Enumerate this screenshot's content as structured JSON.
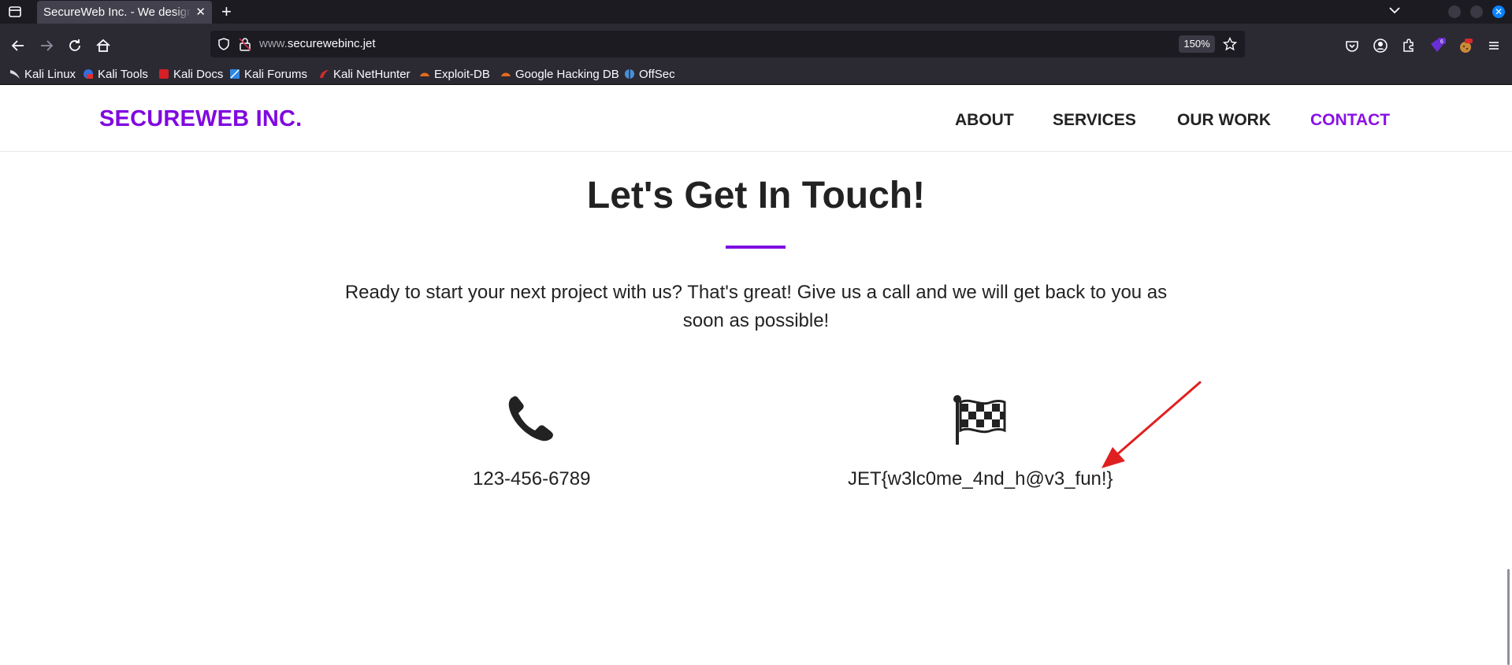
{
  "browser": {
    "tab_title": "SecureWeb Inc. - We design",
    "tab_close": "✕",
    "new_tab": "+",
    "url_prefix": "www.",
    "url_domain": "securewebinc.jet",
    "zoom": "150%",
    "extension_badge": "6",
    "bookmarks": [
      {
        "label": "Kali Linux",
        "icon": "kali-dragon-icon",
        "color": "#000000"
      },
      {
        "label": "Kali Tools",
        "icon": "kali-tools-icon",
        "color": "#2f6fe0"
      },
      {
        "label": "Kali Docs",
        "icon": "kali-docs-icon",
        "color": "#d61f26"
      },
      {
        "label": "Kali Forums",
        "icon": "kali-forums-icon",
        "color": "#2f86e0"
      },
      {
        "label": "Kali NetHunter",
        "icon": "nethunter-icon",
        "color": "#d52b2b"
      },
      {
        "label": "Exploit-DB",
        "icon": "exploit-db-icon",
        "color": "#e46a1e"
      },
      {
        "label": "Google Hacking DB",
        "icon": "ghdb-icon",
        "color": "#e46a1e"
      },
      {
        "label": "OffSec",
        "icon": "offsec-icon",
        "color": "#4a90d9"
      }
    ]
  },
  "site": {
    "brand": "SECUREWEB INC.",
    "brand_color": "#8108e0",
    "nav": [
      {
        "label": "ABOUT",
        "active": false
      },
      {
        "label": "SERVICES",
        "active": false
      },
      {
        "label": "OUR WORK",
        "active": false
      },
      {
        "label": "CONTACT",
        "active": true
      }
    ],
    "heading": "Let's Get In Touch!",
    "lead": "Ready to start your next project with us? That's great! Give us a call and we will get back to you as soon as possible!",
    "contacts": [
      {
        "icon": "phone-icon",
        "text": "123-456-6789"
      },
      {
        "icon": "checkered-flag-icon",
        "text": "JET{w3lc0me_4nd_h@v3_fun!}"
      }
    ],
    "annotation_color": "#e02020"
  }
}
